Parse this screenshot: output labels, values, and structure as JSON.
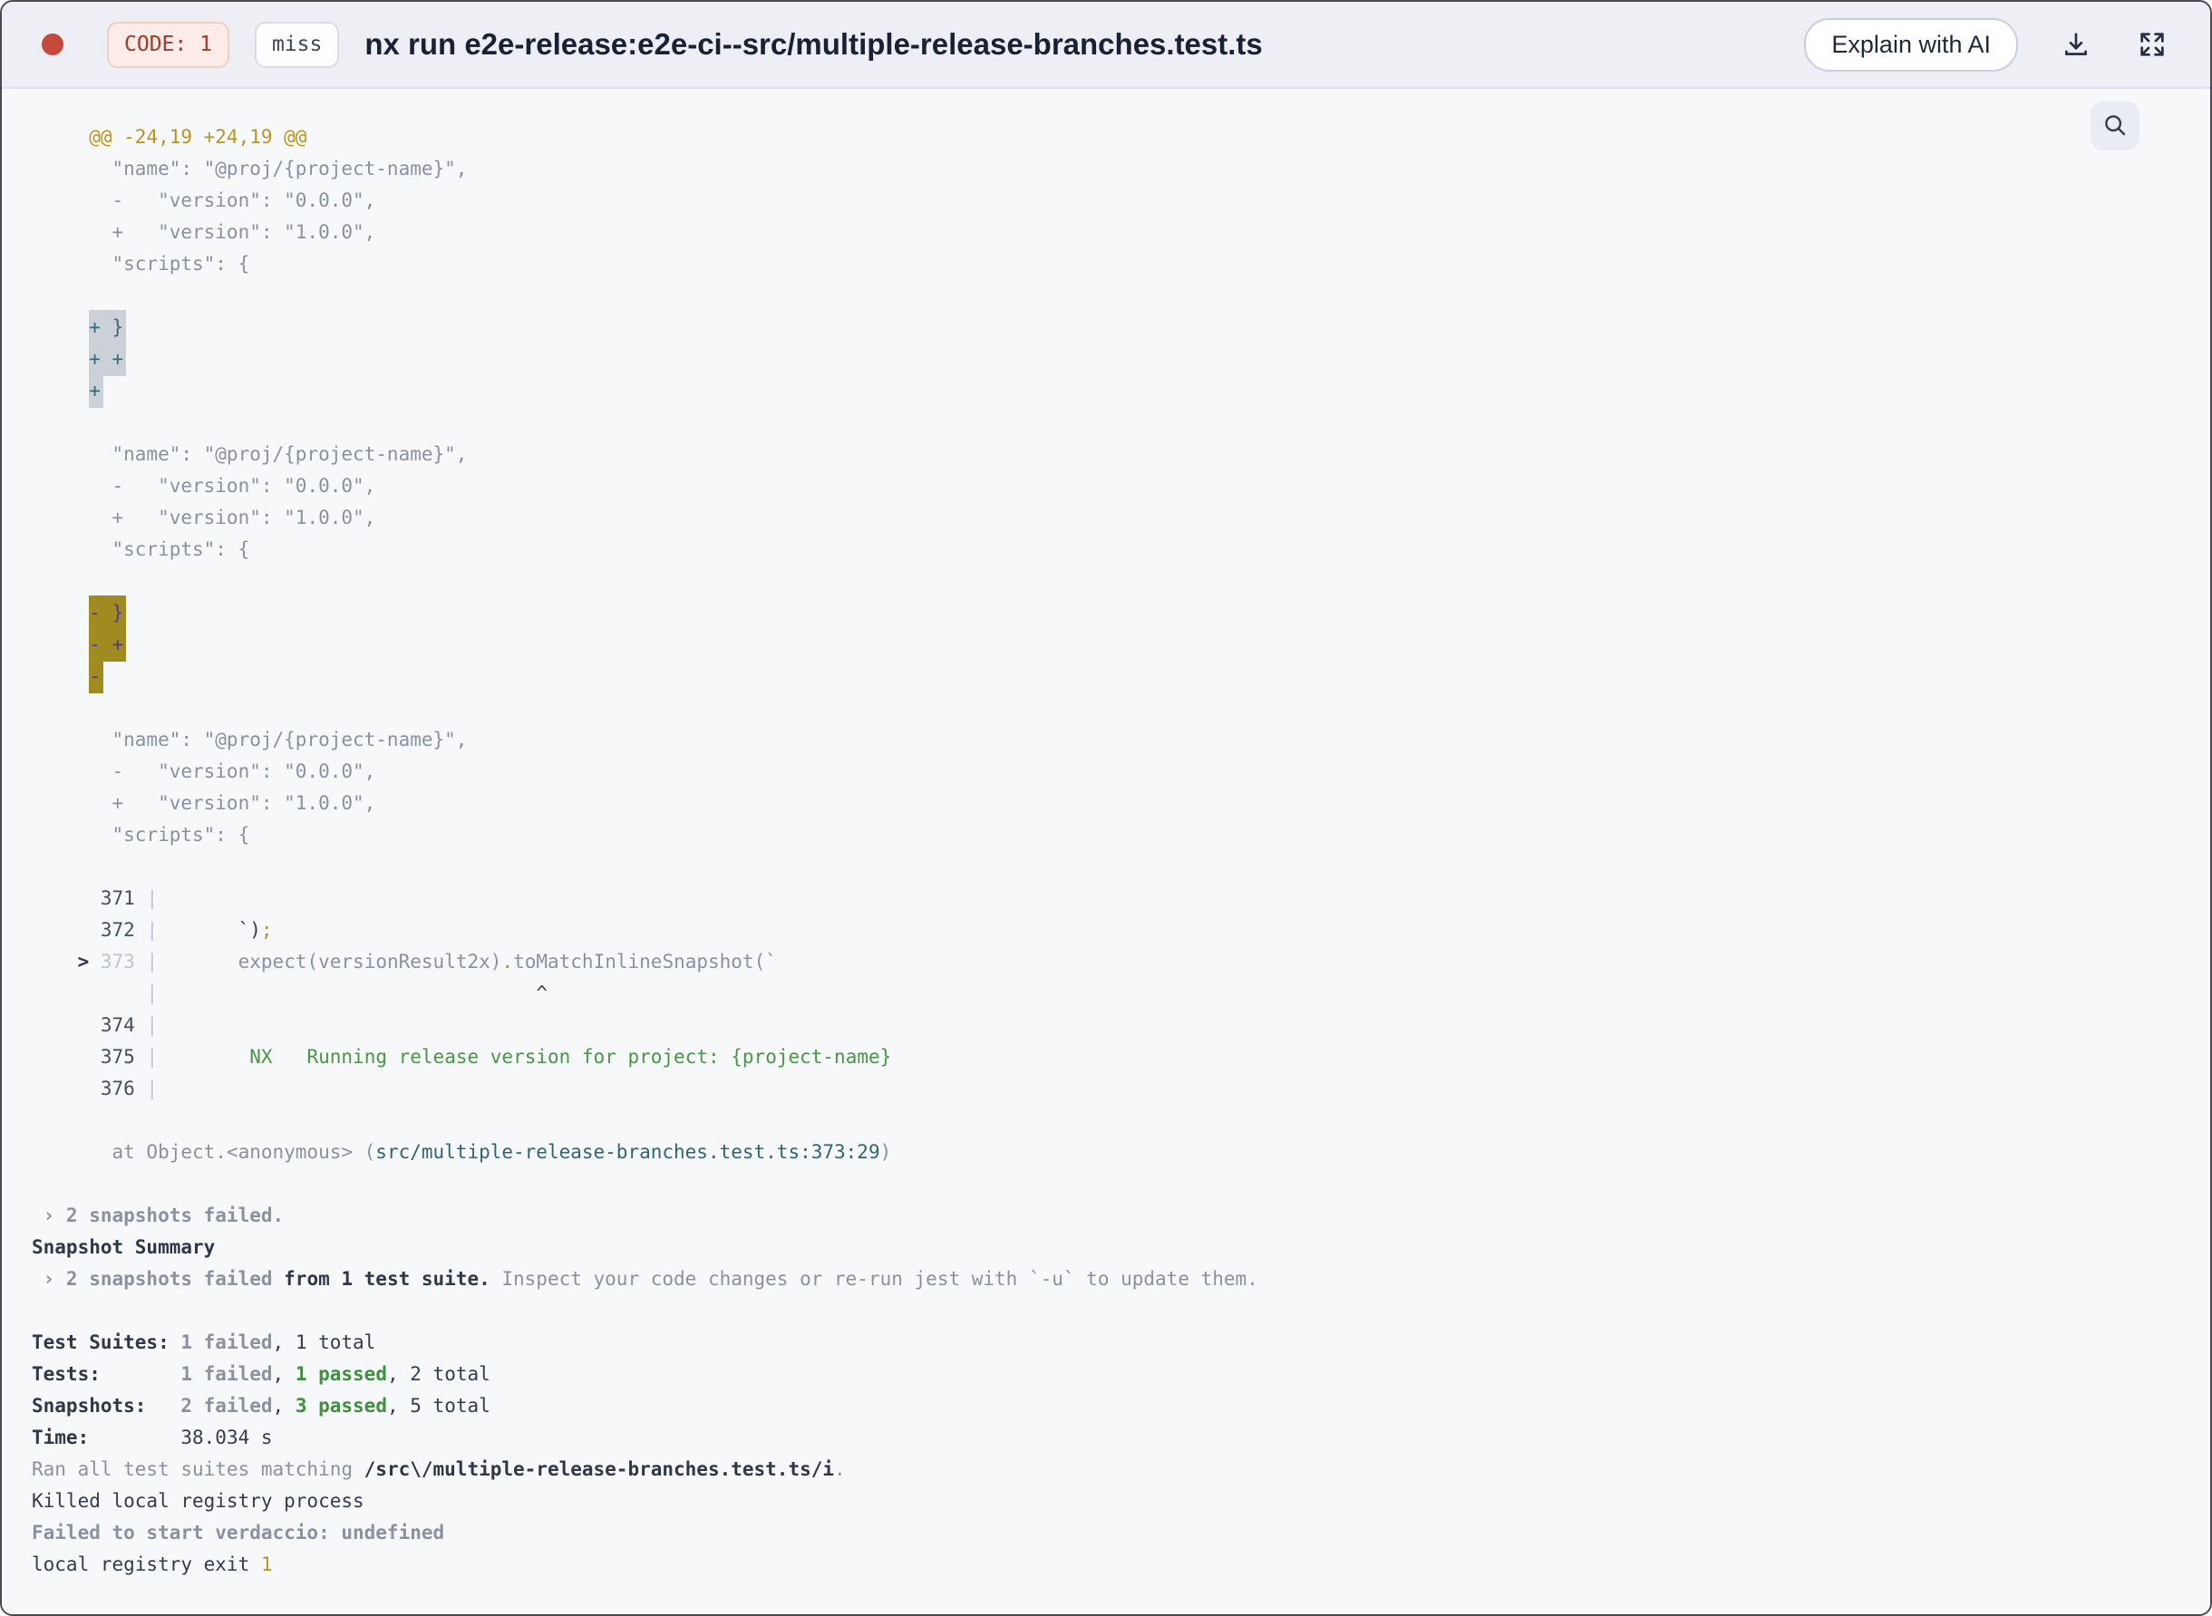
{
  "header": {
    "title": "nx run e2e-release:e2e-ci--src/multiple-release-branches.test.ts",
    "exit_code_badge": "CODE: 1",
    "cache_badge": "miss",
    "explain_button_label": "Explain with AI",
    "status_dot_color": "#c7493d",
    "icons": [
      "download-icon",
      "expand-icon",
      "search-icon"
    ]
  },
  "colors": {
    "header_bg": "#edeff5",
    "content_bg": "#f7f8fa",
    "accent_red": "#c7493d",
    "code_badge_text": "#a23b2b",
    "log_gray": "#8a919f",
    "log_dark": "#333c4e",
    "log_gold": "#bd9320",
    "log_green": "#4a9648",
    "log_teal": "#2e6571",
    "selection_add_bg": "#ccd1d8",
    "selection_add_text": "#34697a",
    "selection_del_bg": "#a18a1f",
    "selection_del_text": "#4a3b9e"
  },
  "terminal": {
    "lines": [
      [
        [
          "     @@ -24,19 +24,19 @@",
          "gold"
        ]
      ],
      [
        [
          "       \"name\": \"@proj/{project-name}\",",
          "gray"
        ]
      ],
      [
        [
          "       -   \"version\": \"0.0.0\",",
          "gray"
        ]
      ],
      [
        [
          "       +   \"version\": \"1.0.0\",",
          "gray"
        ]
      ],
      [
        [
          "       \"scripts\": {",
          "gray"
        ]
      ],
      [],
      [
        [
          "     ",
          "gray"
        ],
        [
          "+ }",
          "seladd"
        ]
      ],
      [
        [
          "     ",
          "gray"
        ],
        [
          "+ +",
          "seladd"
        ]
      ],
      [
        [
          "     ",
          "gray"
        ],
        [
          "+",
          "seladd"
        ]
      ],
      [],
      [
        [
          "       \"name\": \"@proj/{project-name}\",",
          "gray"
        ]
      ],
      [
        [
          "       -   \"version\": \"0.0.0\",",
          "gray"
        ]
      ],
      [
        [
          "       +   \"version\": \"1.0.0\",",
          "gray"
        ]
      ],
      [
        [
          "       \"scripts\": {",
          "gray"
        ]
      ],
      [],
      [
        [
          "     ",
          "gray"
        ],
        [
          "- }",
          "seldel"
        ]
      ],
      [
        [
          "     ",
          "gray"
        ],
        [
          "- +",
          "seldel"
        ]
      ],
      [
        [
          "     ",
          "gray"
        ],
        [
          "-",
          "seldel"
        ]
      ],
      [],
      [
        [
          "       \"name\": \"@proj/{project-name}\",",
          "gray"
        ]
      ],
      [
        [
          "       -   \"version\": \"0.0.0\",",
          "gray"
        ]
      ],
      [
        [
          "       +   \"version\": \"1.0.0\",",
          "gray"
        ]
      ],
      [
        [
          "       \"scripts\": {",
          "gray"
        ]
      ],
      [],
      [
        [
          "      ",
          "gray"
        ],
        [
          "371",
          "num"
        ],
        [
          " ",
          "gray"
        ],
        [
          "|",
          "dim"
        ]
      ],
      [
        [
          "      ",
          "gray"
        ],
        [
          "372",
          "num"
        ],
        [
          " ",
          "gray"
        ],
        [
          "|",
          "dim"
        ],
        [
          "       ",
          "gray"
        ],
        [
          "`)",
          "dark"
        ],
        [
          ";",
          "gold"
        ]
      ],
      [
        [
          "    ",
          "gray"
        ],
        [
          "> ",
          "darkbold"
        ],
        [
          "373",
          "dim"
        ],
        [
          " ",
          "gray"
        ],
        [
          "|",
          "dim"
        ],
        [
          "       expect(versionResult2x)",
          "gray"
        ],
        [
          ".",
          "gold"
        ],
        [
          "toMatchInlineSnapshot(`",
          "gray"
        ]
      ],
      [
        [
          "          ",
          "gray"
        ],
        [
          "|",
          "dim"
        ],
        [
          "                                 ^",
          "dark"
        ]
      ],
      [
        [
          "      ",
          "gray"
        ],
        [
          "374",
          "num"
        ],
        [
          " ",
          "gray"
        ],
        [
          "|",
          "dim"
        ]
      ],
      [
        [
          "      ",
          "gray"
        ],
        [
          "375",
          "num"
        ],
        [
          " ",
          "gray"
        ],
        [
          "|",
          "dim"
        ],
        [
          "        ",
          "gray"
        ],
        [
          "NX   Running release version for project: {project-name}",
          "green"
        ]
      ],
      [
        [
          "      ",
          "gray"
        ],
        [
          "376",
          "num"
        ],
        [
          " ",
          "gray"
        ],
        [
          "|",
          "dim"
        ]
      ],
      [],
      [
        [
          "       at Object.<anonymous> (",
          "gray"
        ],
        [
          "src/multiple-release-branches.test.ts:373:29",
          "teal"
        ],
        [
          ")",
          "gray"
        ]
      ],
      [],
      [
        [
          " › 2 snapshots failed.",
          "graybold"
        ]
      ],
      [
        [
          "Snapshot Summary",
          "darkbold"
        ]
      ],
      [
        [
          " › 2 snapshots failed ",
          "graybold"
        ],
        [
          "from 1 test suite.",
          "darkbold"
        ],
        [
          " Inspect your code changes or re-run jest with `-u` to update them.",
          "gray"
        ]
      ],
      [],
      [
        [
          "Test Suites: ",
          "darkbold"
        ],
        [
          "1 failed",
          "graybold"
        ],
        [
          ", 1 total",
          "dark"
        ]
      ],
      [
        [
          "Tests:       ",
          "darkbold"
        ],
        [
          "1 failed",
          "graybold"
        ],
        [
          ", ",
          "dark"
        ],
        [
          "1 passed",
          "greenbold"
        ],
        [
          ", 2 total",
          "dark"
        ]
      ],
      [
        [
          "Snapshots:   ",
          "darkbold"
        ],
        [
          "2 failed",
          "graybold"
        ],
        [
          ", ",
          "dark"
        ],
        [
          "3 passed",
          "greenbold"
        ],
        [
          ", 5 total",
          "dark"
        ]
      ],
      [
        [
          "Time:        ",
          "darkbold"
        ],
        [
          "38.034 s",
          "dark"
        ]
      ],
      [
        [
          "Ran all test suites matching ",
          "gray"
        ],
        [
          "/src\\/multiple-release-branches.test.ts/i",
          "darkbold"
        ],
        [
          ".",
          "gray"
        ]
      ],
      [
        [
          "Killed local registry process",
          "dark"
        ]
      ],
      [
        [
          "Failed to start verdaccio: undefined",
          "graybold"
        ]
      ],
      [
        [
          "local registry exit ",
          "dark"
        ],
        [
          "1",
          "gold"
        ]
      ]
    ]
  }
}
